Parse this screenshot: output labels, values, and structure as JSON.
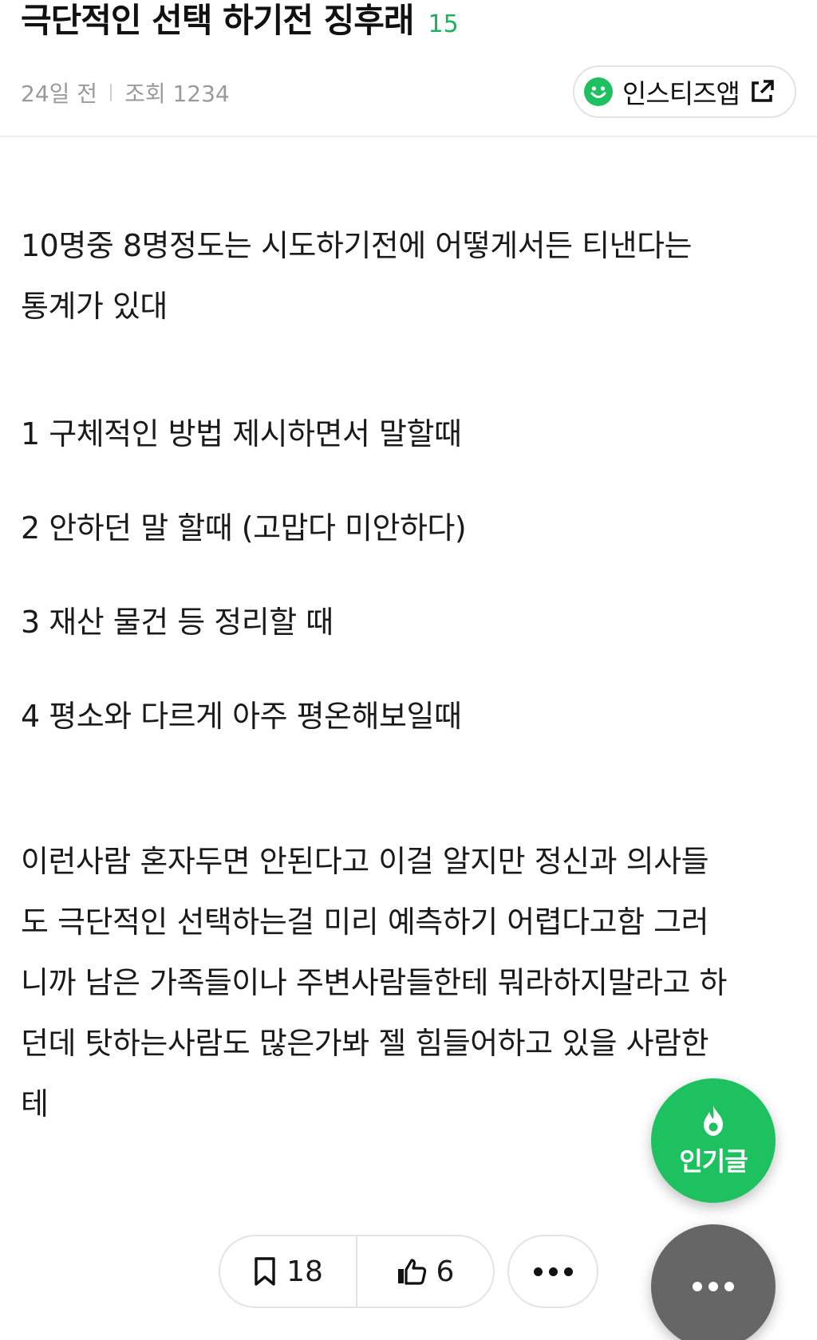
{
  "post": {
    "title": "극단적인 선택 하기전 징후래",
    "comment_count": "15",
    "time_ago": "24일 전",
    "views": "조회 1234"
  },
  "app_button": {
    "label": "인스티즈앱",
    "icon": "smile-icon",
    "ext_icon": "external-link-icon"
  },
  "body": {
    "intro": [
      "10명중 8명정도는 시도하기전에 어떻게서든 티낸다는",
      "통계가 있대"
    ],
    "items": [
      "1 구체적인 방법 제시하면서 말할때",
      "2 안하던 말 할때 (고맙다 미안하다)",
      "3 재산 물건 등 정리할 때",
      "4 평소와 다르게 아주 평온해보일때"
    ],
    "outro": [
      "이런사람 혼자두면 안된다고 이걸 알지만 정신과 의사들",
      "도 극단적인 선택하는걸 미리 예측하기 어렵다고함 그러",
      "니까 남은 가족들이나 주변사람들한테 뭐라하지말라고 하",
      "던데 탓하는사람도 많은가봐 젤 힘들어하고 있을 사람한",
      "테"
    ]
  },
  "actions": {
    "bookmark_count": "18",
    "like_count": "6"
  },
  "fab": {
    "popular_label": "인기글"
  },
  "colors": {
    "accent": "#1ec160",
    "more_fab": "#666666",
    "meta": "#9a9a9a"
  }
}
